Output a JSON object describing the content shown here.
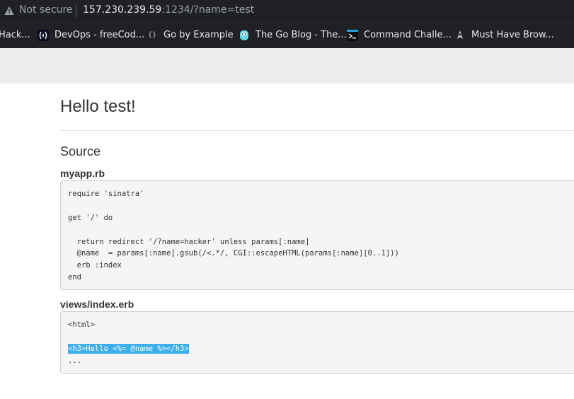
{
  "browser": {
    "security_label": "Not secure",
    "url_host": "157.230.239.59",
    "url_rest": ":1234/?name=test",
    "bookmarks": [
      {
        "label": "Hack...",
        "icon": "none"
      },
      {
        "label": "DevOps - freeCod...",
        "icon": "freecodecamp-icon"
      },
      {
        "label": "Go by Example",
        "icon": "braces-icon"
      },
      {
        "label": "The Go Blog - The...",
        "icon": "gopher-icon"
      },
      {
        "label": "Command Challe...",
        "icon": "terminal-icon"
      },
      {
        "label": "Must Have Brow...",
        "icon": "rocket-icon"
      }
    ]
  },
  "page": {
    "title": "Hello test!",
    "section_title": "Source",
    "files": [
      {
        "name": "myapp.rb",
        "lines": [
          "require 'sinatra'",
          "",
          "get '/' do",
          "",
          "  return redirect '/?name=hacker' unless params[:name]",
          "  @name  = params[:name].gsub(/<.*/, CGI::escapeHTML(params[:name][0..1]))",
          "  erb :index",
          "end"
        ]
      },
      {
        "name": "views/index.erb",
        "lines": [
          "<html>",
          "",
          "<h3>Hello <%= @name %></h3>",
          "..."
        ],
        "selected_line": "<h3>Hello <%= @name %></h3>"
      }
    ]
  },
  "colors": {
    "chrome_bg": "#202124",
    "selection": "#3daee9",
    "code_bg": "#f5f5f5"
  }
}
